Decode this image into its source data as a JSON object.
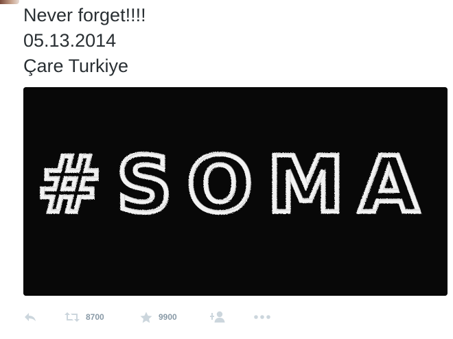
{
  "tweet": {
    "lines": [
      "Never forget!!!!",
      "05.13.2014",
      "Çare Turkiye"
    ]
  },
  "media": {
    "image_text": "#SOMA",
    "background": "#080808",
    "text_color": "#f2f2f2"
  },
  "actions": {
    "reply": {
      "icon": "reply-icon"
    },
    "retweet": {
      "icon": "retweet-icon",
      "count": "8700"
    },
    "favorite": {
      "icon": "star-icon",
      "count": "9900"
    },
    "follow": {
      "icon": "follow-icon"
    },
    "more": {
      "icon": "more-icon"
    },
    "icon_color": "#ccd6dd",
    "count_color": "#8899a6"
  }
}
